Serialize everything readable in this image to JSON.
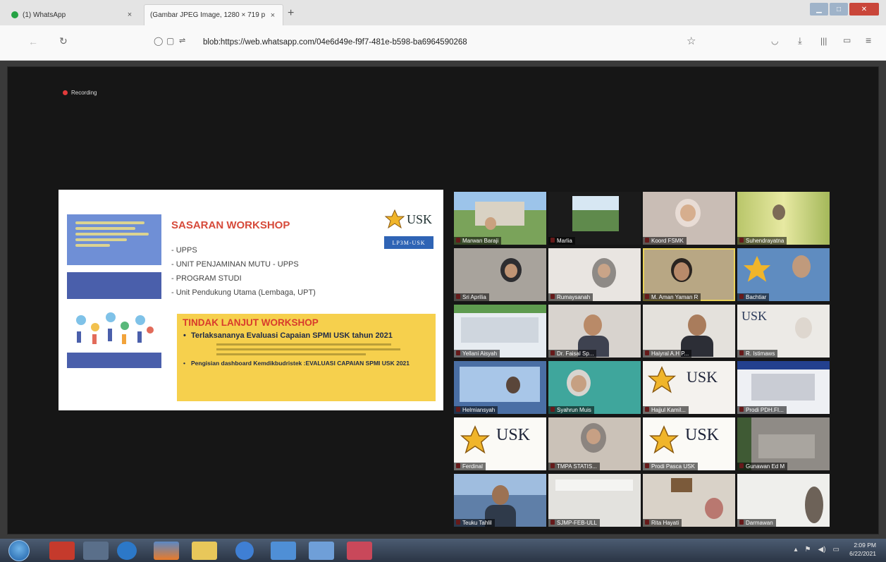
{
  "browser": {
    "tabs": [
      {
        "title": "(1) WhatsApp",
        "close": "×"
      },
      {
        "title": "(Gambar JPEG Image, 1280 × 719 p",
        "close": "×"
      }
    ],
    "new_tab": "+",
    "url": "blob:https://web.whatsapp.com/04e6d49e-f9f7-481e-b598-ba6964590268"
  },
  "meeting": {
    "recording_label": "Recording"
  },
  "slide": {
    "title": "SASARAN WORKSHOP",
    "list": [
      "UPPS",
      "UNIT PENJAMINAN MUTU - UPPS",
      "PROGRAM STUDI",
      "Unit Pendukung Utama (Lembaga, UPT)"
    ],
    "logo_text": "USK",
    "badge": "LP3M-USK",
    "tindak_title": "TINDAK LANJUT WORKSHOP",
    "tindak_item_1": "Terlaksananya Evaluasi Capaian SPMI USK tahun 2021",
    "tindak_item_2": "Pengisian dashboard Kemdikbudristek :EVALUASI CAPAIAN SPMI USK 2021"
  },
  "participants": [
    {
      "name": "Marwan Baraji"
    },
    {
      "name": "Marlia"
    },
    {
      "name": "Koord FSMK"
    },
    {
      "name": "Suhendrayatna"
    },
    {
      "name": "Sri Aprilia"
    },
    {
      "name": "Rumaysanah"
    },
    {
      "name": "M. Aman Yaman R"
    },
    {
      "name": "Bachtiar"
    },
    {
      "name": "Yellani Aisyah"
    },
    {
      "name": "Dr. Faisal Sp..."
    },
    {
      "name": "Haiyral A.H P..."
    },
    {
      "name": "R. Istimaws"
    },
    {
      "name": "Helmiansyah"
    },
    {
      "name": "Syahrun Muis"
    },
    {
      "name": "Hajjul Kamil..."
    },
    {
      "name": "Prodi PDH.FI..."
    },
    {
      "name": "Ferdinal"
    },
    {
      "name": "TMPA STATIS..."
    },
    {
      "name": "Prodi Pasca USK"
    },
    {
      "name": "Gunawan Ed M"
    },
    {
      "name": "Teuku Tahlil"
    },
    {
      "name": "SJMP-FEB-ULL"
    },
    {
      "name": "Rita Hayati"
    },
    {
      "name": "Darmawan"
    }
  ],
  "taskbar": {
    "clock_time": "2:09 PM",
    "clock_date": "6/22/2021"
  }
}
